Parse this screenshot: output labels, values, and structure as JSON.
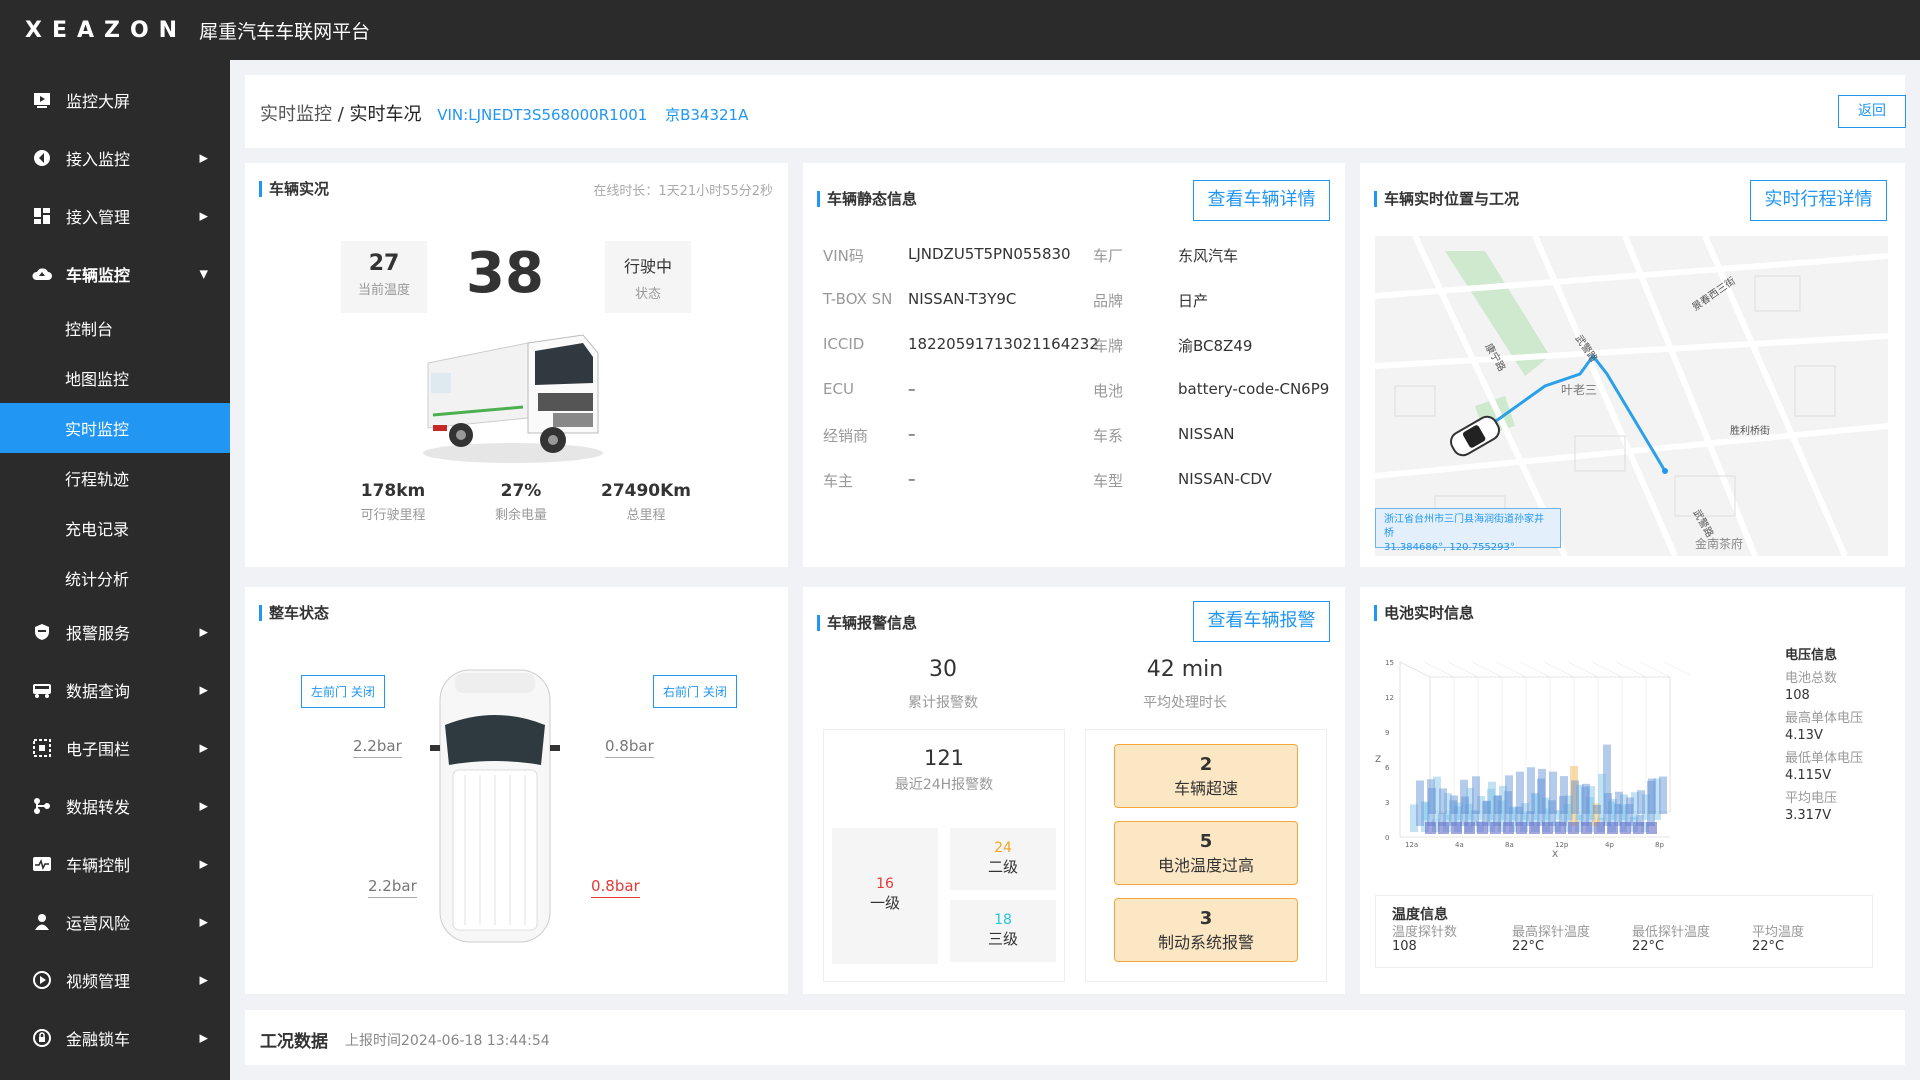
{
  "app": {
    "logo": "XEAZON",
    "title": "犀重汽车车联网平台"
  },
  "sidebar": {
    "items": [
      {
        "label": "监控大屏",
        "icon": "monitor-icon",
        "arrow": ""
      },
      {
        "label": "接入监控",
        "icon": "access-icon",
        "arrow": "▶"
      },
      {
        "label": "接入管理",
        "icon": "grid-icon",
        "arrow": "▶"
      },
      {
        "label": "车辆监控",
        "icon": "cloud-icon",
        "arrow": "▼"
      }
    ],
    "subitems": [
      "控制台",
      "地图监控",
      "实时监控",
      "行程轨迹",
      "充电记录",
      "统计分析"
    ],
    "items2": [
      {
        "label": "报警服务",
        "icon": "shield-icon"
      },
      {
        "label": "数据查询",
        "icon": "bus-icon"
      },
      {
        "label": "电子围栏",
        "icon": "fence-icon"
      },
      {
        "label": "数据转发",
        "icon": "forward-icon"
      },
      {
        "label": "车辆控制",
        "icon": "control-icon"
      },
      {
        "label": "运营风险",
        "icon": "risk-icon"
      },
      {
        "label": "视频管理",
        "icon": "video-icon"
      },
      {
        "label": "金融锁车",
        "icon": "lock-icon"
      }
    ],
    "arrow": "▶"
  },
  "breadcrumb": {
    "parent": "实时监控",
    "sep": " / ",
    "current": "实时车况",
    "vin": "VIN:LJNEDT3S568000R1001",
    "plate": "京B34321A",
    "back": "返回"
  },
  "vehicle": {
    "title": "车辆实况",
    "online": "在线时长：1天21小时55分2秒",
    "temp": "27",
    "temp_label": "当前温度",
    "speed": "38",
    "status": "行驶中",
    "status_label": "状态",
    "range": "178km",
    "range_label": "可行驶里程",
    "soc": "27%",
    "soc_label": "剩余电量",
    "odo": "27490Km",
    "odo_label": "总里程"
  },
  "static": {
    "title": "车辆静态信息",
    "btn": "查看车辆详情",
    "rows": [
      {
        "k1": "VIN码",
        "v1": "LJNDZU5T5PN055830",
        "k2": "车厂",
        "v2": "东风汽车"
      },
      {
        "k1": "T-BOX SN",
        "v1": "NISSAN-T3Y9C",
        "k2": "品牌",
        "v2": "日产"
      },
      {
        "k1": "ICCID",
        "v1": "18220591713021164232",
        "k2": "车牌",
        "v2": "渝BC8Z49"
      },
      {
        "k1": "ECU",
        "v1": "–",
        "k2": "电池",
        "v2": "battery-code-CN6P9"
      },
      {
        "k1": "经销商",
        "v1": "–",
        "k2": "车系",
        "v2": "NISSAN"
      },
      {
        "k1": "车主",
        "v1": "–",
        "k2": "车型",
        "v2": "NISSAN-CDV"
      }
    ]
  },
  "location": {
    "title": "车辆实时位置与工况",
    "btn": "实时行程详情",
    "address": "浙江省台州市三门县海润街道孙家井桥",
    "coords": "31.384686°, 120.755293°",
    "roads": [
      "康宁路",
      "武警路",
      "叶老三",
      "武警路",
      "胜利桥街",
      "景春西三街"
    ],
    "poi": "金南茶府"
  },
  "whole": {
    "title": "整车状态",
    "left_door": "左前门 关闭",
    "right_door": "右前门 关闭",
    "fl": "2.2bar",
    "fr": "0.8bar",
    "rl": "2.2bar",
    "rr": "0.8bar",
    "warn_color": "#e53935"
  },
  "alarm": {
    "title": "车辆报警信息",
    "btn": "查看车辆报警",
    "total": "30",
    "total_label": "累计报警数",
    "avg": "42 min",
    "avg_label": "平均处理时长",
    "last24": "121",
    "last24_label": "最近24H报警数",
    "lv1": "16",
    "lv1_label": "一级",
    "lv2": "24",
    "lv2_label": "二级",
    "lv3": "18",
    "lv3_label": "三级",
    "list": [
      {
        "count": "2",
        "name": "车辆超速"
      },
      {
        "count": "5",
        "name": "电池温度过高"
      },
      {
        "count": "3",
        "name": "制动系统报警"
      }
    ]
  },
  "battery": {
    "title": "电池实时信息",
    "volt_title": "电压信息",
    "total_label": "电池总数",
    "total": "108",
    "max_label": "最高单体电压",
    "max": "4.13V",
    "min_label": "最低单体电压",
    "min": "4.115V",
    "avg_label": "平均电压",
    "avg": "3.317V",
    "temp_title": "温度信息",
    "probes_label": "温度探针数",
    "probes": "108",
    "tmax_label": "最高探针温度",
    "tmax": "22°C",
    "tmin_label": "最低探针温度",
    "tmin": "22°C",
    "tavg_label": "平均温度",
    "tavg": "22°C"
  },
  "chart_data": {
    "type": "bar",
    "zlabel": "Z",
    "xlabel": "X",
    "z_ticks": [
      "0",
      "3",
      "6",
      "9",
      "12",
      "15"
    ],
    "x_ticks": [
      "12a",
      "4a",
      "8a",
      "12p",
      "4p",
      "8p"
    ],
    "zlim": [
      0,
      15
    ]
  },
  "work": {
    "title": "工况数据",
    "time": "上报时间2024-06-18 13:44:54"
  },
  "colors": {
    "accent": "#2196f3",
    "sidebar": "#2b2b2b",
    "alarm_bg": "#fce7c5",
    "alarm_border": "#f3a73b",
    "lv2": "#f5a623",
    "lv1": "#e53935",
    "lv3": "#26c6da"
  }
}
